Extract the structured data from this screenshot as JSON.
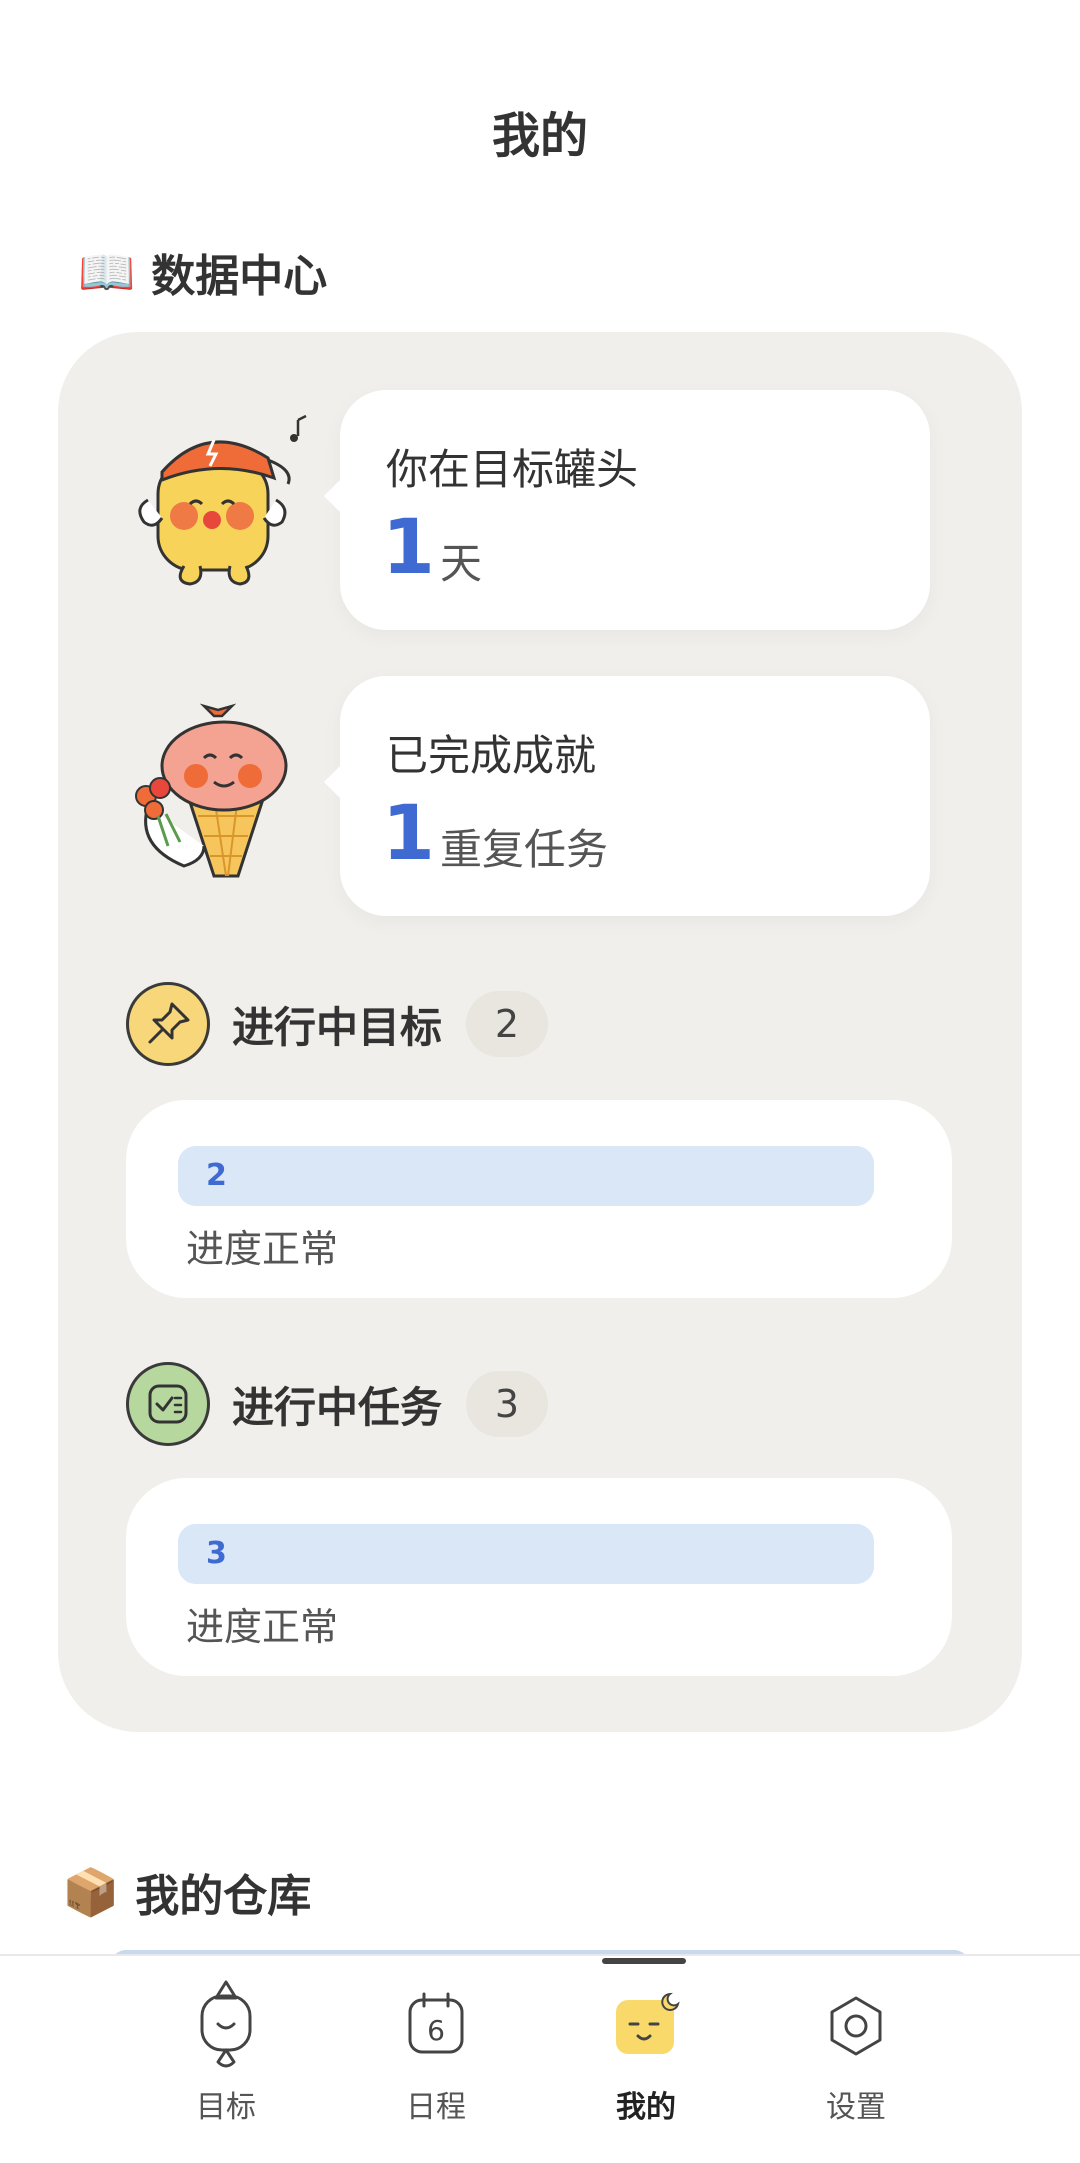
{
  "header": {
    "title": "我的"
  },
  "data_center": {
    "emoji": "📖",
    "title": "数据中心",
    "stats": [
      {
        "label": "你在目标罐头",
        "value": "1",
        "unit": "天"
      },
      {
        "label": "已完成成就",
        "value": "1",
        "unit": "重复任务"
      }
    ],
    "goals": {
      "title": "进行中目标",
      "count": "2",
      "bar_value": "2",
      "status": "进度正常",
      "progress_fraction": 1.0
    },
    "tasks": {
      "title": "进行中任务",
      "count": "3",
      "bar_value": "3",
      "status": "进度正常",
      "progress_fraction": 1.0
    }
  },
  "warehouse": {
    "emoji": "📦",
    "title": "我的仓库"
  },
  "tabbar": {
    "items": [
      {
        "label": "目标",
        "icon": "goal-icon"
      },
      {
        "label": "日程",
        "icon": "calendar-icon",
        "date": "6"
      },
      {
        "label": "我的",
        "icon": "mascot-icon",
        "active": true
      },
      {
        "label": "设置",
        "icon": "settings-hex-icon"
      }
    ]
  },
  "colors": {
    "accent_blue": "#3e6ad1",
    "bar_bg": "#d9e7f7",
    "panel_bg": "#f1efeb",
    "goal_icon_bg": "#f8d77a",
    "task_icon_bg": "#b6d79d"
  }
}
